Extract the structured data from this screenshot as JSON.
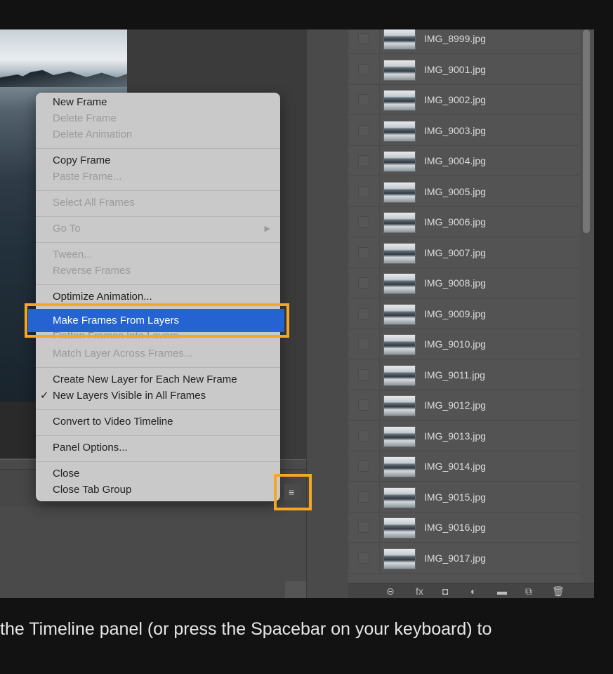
{
  "menu": {
    "items": [
      {
        "label": "New Frame",
        "enabled": true
      },
      {
        "label": "Delete Frame",
        "enabled": false
      },
      {
        "label": "Delete Animation",
        "enabled": false
      },
      {
        "label": "Copy Frame",
        "enabled": true
      },
      {
        "label": "Paste Frame...",
        "enabled": false
      },
      {
        "label": "Select All Frames",
        "enabled": false
      },
      {
        "label": "Go To",
        "enabled": false,
        "submenu_arrow": "▶"
      },
      {
        "label": "Tween...",
        "enabled": false
      },
      {
        "label": "Reverse Frames",
        "enabled": false
      },
      {
        "label": "Optimize Animation...",
        "enabled": true
      },
      {
        "label": "Make Frames From Layers",
        "enabled": true,
        "highlighted": true
      },
      {
        "label": "Flatten Frames Into Layers",
        "enabled": false
      },
      {
        "label": "Match Layer Across Frames...",
        "enabled": false
      },
      {
        "label": "Create New Layer for Each New Frame",
        "enabled": true
      },
      {
        "label": "New Layers Visible in All Frames",
        "enabled": true,
        "checked": true,
        "check": "✓"
      },
      {
        "label": "Convert to Video Timeline",
        "enabled": true
      },
      {
        "label": "Panel Options...",
        "enabled": true
      },
      {
        "label": "Close",
        "enabled": true
      },
      {
        "label": "Close Tab Group",
        "enabled": true
      }
    ]
  },
  "panel_menu_button": {
    "icon": "hamburger-menu-icon",
    "glyph": "≡"
  },
  "layers": [
    "IMG_8999.jpg",
    "IMG_9001.jpg",
    "IMG_9002.jpg",
    "IMG_9003.jpg",
    "IMG_9004.jpg",
    "IMG_9005.jpg",
    "IMG_9006.jpg",
    "IMG_9007.jpg",
    "IMG_9008.jpg",
    "IMG_9009.jpg",
    "IMG_9010.jpg",
    "IMG_9011.jpg",
    "IMG_9012.jpg",
    "IMG_9013.jpg",
    "IMG_9014.jpg",
    "IMG_9015.jpg",
    "IMG_9016.jpg",
    "IMG_9017.jpg"
  ],
  "layers_footer": {
    "icons": [
      {
        "name": "link-layers-icon",
        "glyph": "⊝"
      },
      {
        "name": "fx-icon",
        "glyph": "fx"
      },
      {
        "name": "layer-mask-icon",
        "glyph": "◘"
      },
      {
        "name": "adjustment-layer-icon",
        "glyph": "◐"
      },
      {
        "name": "new-group-icon",
        "glyph": "▬"
      },
      {
        "name": "new-layer-icon",
        "glyph": "⧉"
      },
      {
        "name": "trash-icon",
        "glyph": "🗑"
      }
    ]
  },
  "caption": "the Timeline panel (or press the Spacebar on your keyboard) to",
  "colors": {
    "highlight": "#2463d1",
    "callout": "#f5a623"
  }
}
